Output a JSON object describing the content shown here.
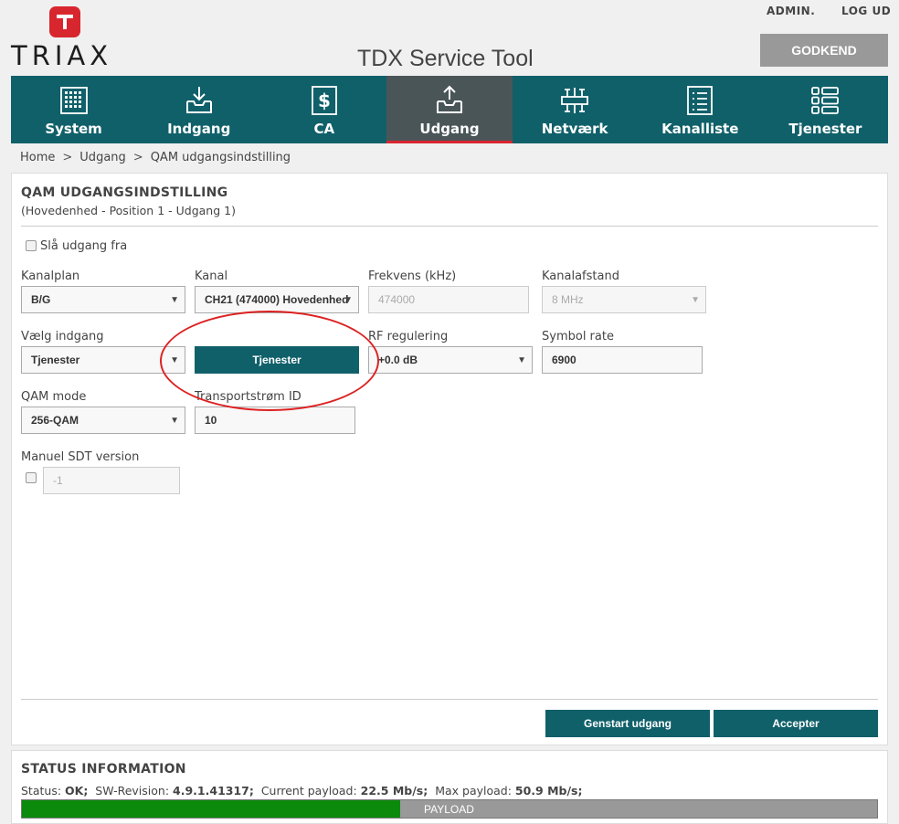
{
  "header": {
    "logo_text": "TRIAX",
    "app_title": "TDX Service Tool",
    "admin_label": "ADMIN.",
    "logout_label": "LOG UD",
    "approve_label": "GODKEND"
  },
  "nav": {
    "items": [
      {
        "label": "System",
        "icon": "system-icon",
        "active": false
      },
      {
        "label": "Indgang",
        "icon": "input-download-icon",
        "active": false
      },
      {
        "label": "CA",
        "icon": "ca-dollar-icon",
        "active": false
      },
      {
        "label": "Udgang",
        "icon": "output-upload-icon",
        "active": true
      },
      {
        "label": "Netværk",
        "icon": "network-icon",
        "active": false
      },
      {
        "label": "Kanalliste",
        "icon": "channel-list-icon",
        "active": false
      },
      {
        "label": "Tjenester",
        "icon": "services-icon",
        "active": false
      }
    ]
  },
  "breadcrumb": [
    "Home",
    "Udgang",
    "QAM udgangsindstilling"
  ],
  "panel": {
    "title": "QAM UDGANGSINDSTILLING",
    "subtitle": "(Hovedenhed - Position 1 - Udgang 1)",
    "disable_output_label": "Slå udgang fra",
    "fields": {
      "kanalplan": {
        "label": "Kanalplan",
        "value": "B/G"
      },
      "kanal": {
        "label": "Kanal",
        "value": "CH21 (474000) Hovedenhed"
      },
      "frekvens": {
        "label": "Frekvens (kHz)",
        "value": "474000"
      },
      "kanalafstand": {
        "label": "Kanalafstand",
        "value": "8 MHz"
      },
      "vaelg_indgang": {
        "label": "Vælg indgang",
        "value": "Tjenester"
      },
      "tjenester_button": "Tjenester",
      "rf_regulering": {
        "label": "RF regulering",
        "value": "+0.0 dB"
      },
      "symbol_rate": {
        "label": "Symbol rate",
        "value": "6900"
      },
      "qam_mode": {
        "label": "QAM mode",
        "value": "256-QAM"
      },
      "transportstroem": {
        "label": "Transportstrøm ID",
        "value": "10"
      },
      "manuel_sdt": {
        "label": "Manuel SDT version",
        "value": "-1"
      }
    },
    "restart_label": "Genstart udgang",
    "accept_label": "Accepter"
  },
  "status": {
    "title": "STATUS INFORMATION",
    "status_key": "Status:",
    "status_val": "OK;",
    "sw_key": "SW-Revision:",
    "sw_val": "4.9.1.41317;",
    "cur_key": "Current payload:",
    "cur_val": "22.5 Mb/s;",
    "max_key": "Max payload:",
    "max_val": "50.9 Mb/s;",
    "payload_label": "PAYLOAD",
    "payload_fraction": 0.442
  },
  "colors": {
    "nav_bg": "#10606a",
    "active_tab": "#4a5558",
    "accent_red": "#d8262e",
    "payload_green": "#0c8a0c"
  }
}
